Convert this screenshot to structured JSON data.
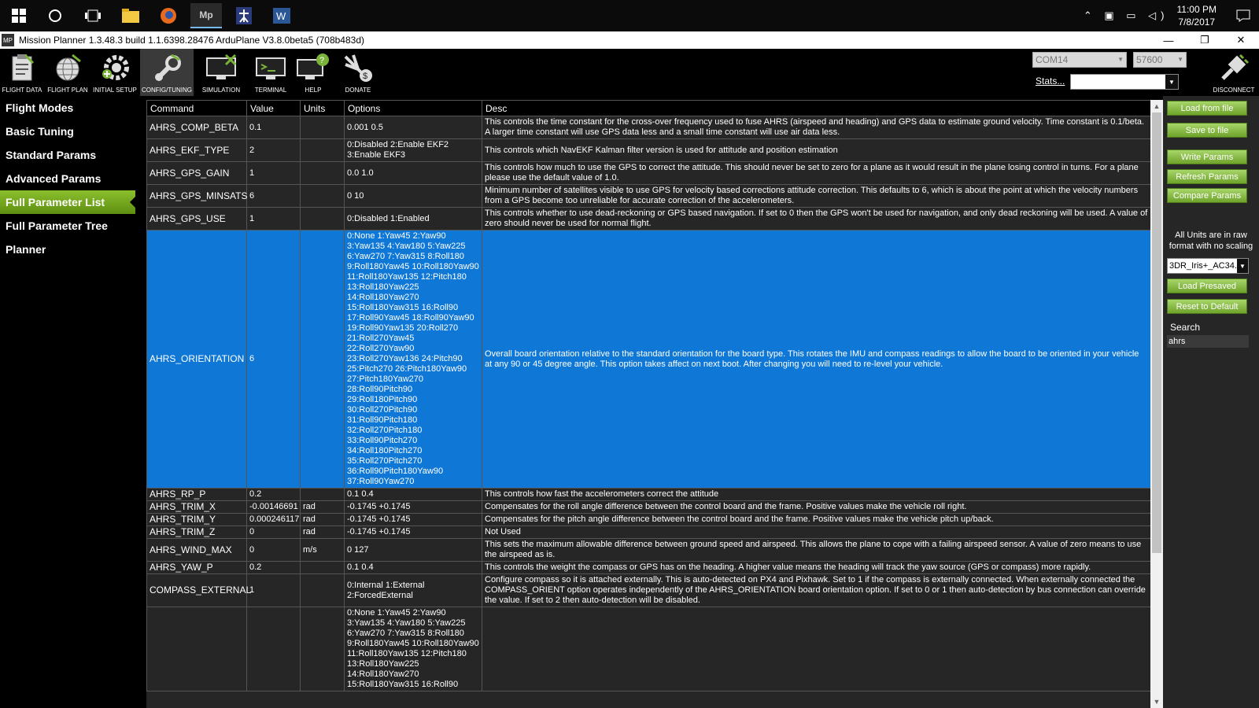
{
  "taskbar": {
    "time": "11:00 PM",
    "date": "7/8/2017",
    "icons": [
      "windows-start-icon",
      "search-circle-icon",
      "task-view-icon",
      "file-explorer-icon",
      "firefox-icon",
      "mission-planner-icon",
      "figure-app-icon",
      "word-icon"
    ]
  },
  "window": {
    "title": "Mission Planner 1.3.48.3 build 1.1.6398.28476 ArduPlane V3.8.0beta5 (708b483d)",
    "app_icon_text": "MP",
    "minimize": "—",
    "maximize": "❐",
    "close": "✕"
  },
  "toolbar": {
    "items": [
      {
        "label": "FLIGHT DATA"
      },
      {
        "label": "FLIGHT PLAN"
      },
      {
        "label": "INITIAL SETUP"
      },
      {
        "label": "CONFIG/TUNING"
      },
      {
        "label": "SIMULATION"
      },
      {
        "label": "TERMINAL"
      },
      {
        "label": "HELP"
      },
      {
        "label": "DONATE"
      }
    ],
    "port": "COM14",
    "baud": "57600",
    "stats_label": "Stats...",
    "disconnect_label": "DISCONNECT"
  },
  "sidebar": {
    "items": [
      {
        "label": "Flight Modes"
      },
      {
        "label": "Basic Tuning"
      },
      {
        "label": "Standard Params"
      },
      {
        "label": "Advanced Params"
      },
      {
        "label": "Full Parameter List"
      },
      {
        "label": "Full Parameter Tree"
      },
      {
        "label": "Planner"
      }
    ],
    "active_index": 4
  },
  "table": {
    "headers": {
      "command": "Command",
      "value": "Value",
      "units": "Units",
      "options": "Options",
      "desc": "Desc"
    },
    "rows": [
      {
        "command": "AHRS_COMP_BETA",
        "value": "0.1",
        "units": "",
        "options": "0.001 0.5",
        "desc": "This controls the time constant for the cross-over frequency used to fuse AHRS (airspeed and heading) and GPS data to estimate ground velocity. Time constant is 0.1/beta. A larger time constant will use GPS data less and a small time constant will use air data less."
      },
      {
        "command": "AHRS_EKF_TYPE",
        "value": "2",
        "units": "",
        "options": "0:Disabled 2:Enable EKF2\n3:Enable EKF3",
        "desc": "This controls which NavEKF Kalman filter version is used for attitude and position estimation"
      },
      {
        "command": "AHRS_GPS_GAIN",
        "value": "1",
        "units": "",
        "options": "0.0 1.0",
        "desc": "This controls how much to use the GPS to correct the attitude. This should never be set to zero for a plane as it would result in the plane losing control in turns. For a plane please use the default value of 1.0."
      },
      {
        "command": "AHRS_GPS_MINSATS",
        "value": "6",
        "units": "",
        "options": "0 10",
        "desc": "Minimum number of satellites visible to use GPS for velocity based corrections attitude correction. This defaults to 6, which is about the point at which the velocity numbers from a GPS become too unreliable for accurate correction of the accelerometers."
      },
      {
        "command": "AHRS_GPS_USE",
        "value": "1",
        "units": "",
        "options": "0:Disabled 1:Enabled",
        "desc": "This controls whether to use dead-reckoning or GPS based navigation. If set to 0 then the GPS won't be used for navigation, and only dead reckoning will be used. A value of zero should never be used for normal flight."
      },
      {
        "command": "AHRS_ORIENTATION",
        "value": "6",
        "units": "",
        "options": "0:None 1:Yaw45 2:Yaw90\n3:Yaw135 4:Yaw180 5:Yaw225\n6:Yaw270 7:Yaw315 8:Roll180\n9:Roll180Yaw45 10:Roll180Yaw90\n11:Roll180Yaw135 12:Pitch180\n13:Roll180Yaw225\n14:Roll180Yaw270\n15:Roll180Yaw315 16:Roll90\n17:Roll90Yaw45 18:Roll90Yaw90\n19:Roll90Yaw135 20:Roll270\n21:Roll270Yaw45\n22:Roll270Yaw90\n23:Roll270Yaw136 24:Pitch90\n25:Pitch270 26:Pitch180Yaw90\n27:Pitch180Yaw270\n28:Roll90Pitch90\n29:Roll180Pitch90\n30:Roll270Pitch90\n31:Roll90Pitch180\n32:Roll270Pitch180\n33:Roll90Pitch270\n34:Roll180Pitch270\n35:Roll270Pitch270\n36:Roll90Pitch180Yaw90\n37:Roll90Yaw270",
        "desc": "Overall board orientation relative to the standard orientation for the board type. This rotates the IMU and compass readings to allow the board to be oriented in your vehicle at any 90 or 45 degree angle. This option takes affect on next boot. After changing you will need to re-level your vehicle.",
        "selected": true
      },
      {
        "command": "AHRS_RP_P",
        "value": "0.2",
        "units": "",
        "options": "0.1 0.4",
        "desc": "This controls how fast the accelerometers correct the attitude"
      },
      {
        "command": "AHRS_TRIM_X",
        "value": "-0.00146691",
        "units": "rad",
        "options": "-0.1745 +0.1745",
        "desc": "Compensates for the roll angle difference between the control board and the frame. Positive values make the vehicle roll right."
      },
      {
        "command": "AHRS_TRIM_Y",
        "value": "0.000246117",
        "units": "rad",
        "options": "-0.1745 +0.1745",
        "desc": "Compensates for the pitch angle difference between the control board and the frame. Positive values make the vehicle pitch up/back."
      },
      {
        "command": "AHRS_TRIM_Z",
        "value": "0",
        "units": "rad",
        "options": "-0.1745 +0.1745",
        "desc": "Not Used"
      },
      {
        "command": "AHRS_WIND_MAX",
        "value": "0",
        "units": "m/s",
        "options": "0 127",
        "desc": "This sets the maximum allowable difference between ground speed and airspeed. This allows the plane to cope with a failing airspeed sensor. A value of zero means to use the airspeed as is."
      },
      {
        "command": "AHRS_YAW_P",
        "value": "0.2",
        "units": "",
        "options": "0.1 0.4",
        "desc": "This controls the weight the compass or GPS has on the heading. A higher value means the heading will track the yaw source (GPS or compass) more rapidly."
      },
      {
        "command": "COMPASS_EXTERNAL",
        "value": "1",
        "units": "",
        "options": "0:Internal 1:External\n2:ForcedExternal",
        "desc": "Configure compass so it is attached externally. This is auto-detected on PX4 and Pixhawk. Set to 1 if the compass is externally connected. When externally connected the COMPASS_ORIENT option operates independently of the AHRS_ORIENTATION board orientation option. If set to 0 or 1 then auto-detection by bus connection can override the value. If set to 2 then auto-detection will be disabled."
      },
      {
        "command": "",
        "value": "",
        "units": "",
        "options": "0:None 1:Yaw45 2:Yaw90\n3:Yaw135 4:Yaw180 5:Yaw225\n6:Yaw270 7:Yaw315 8:Roll180\n9:Roll180Yaw45 10:Roll180Yaw90\n11:Roll180Yaw135 12:Pitch180\n13:Roll180Yaw225\n14:Roll180Yaw270\n15:Roll180Yaw315 16:Roll90",
        "desc": ""
      }
    ]
  },
  "right_panel": {
    "load_from_file": "Load from file",
    "save_to_file": "Save to file",
    "write_params": "Write Params",
    "refresh_params": "Refresh Params",
    "compare_params": "Compare Params",
    "units_note": "All Units are in raw format with no scaling",
    "file_select": "3DR_Iris+_AC34.",
    "load_presaved": "Load Presaved",
    "reset_default": "Reset to Default",
    "search_label": "Search",
    "search_value": "ahrs"
  },
  "colors": {
    "accent_green": "#7ab33a",
    "selection_blue": "#0f78d7",
    "grid_bg": "#262626"
  }
}
